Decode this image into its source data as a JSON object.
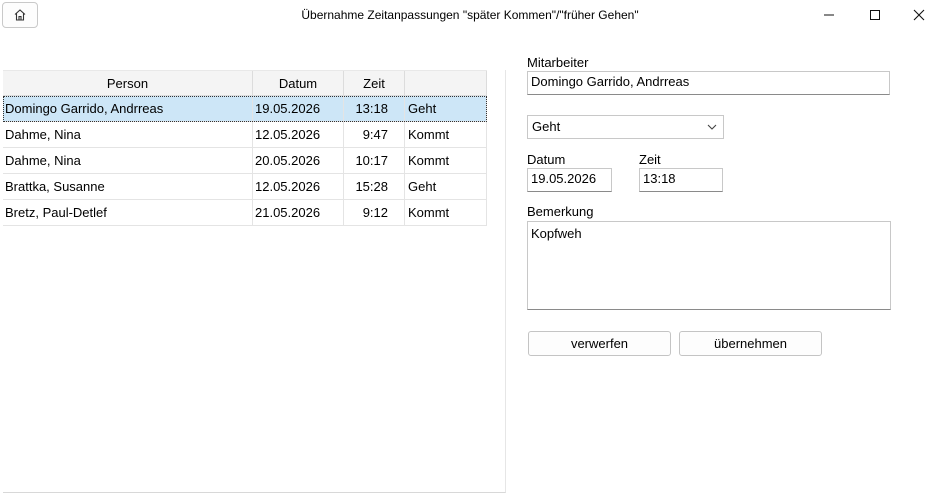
{
  "window": {
    "title": "Übernahme Zeitanpassungen \"später Kommen\"/\"früher Gehen\"",
    "home_icon": "home-icon",
    "minimize_icon": "minimize-icon",
    "maximize_icon": "maximize-icon",
    "close_icon": "close-icon"
  },
  "grid": {
    "columns": [
      "Person",
      "Datum",
      "Zeit",
      ""
    ],
    "rows": [
      {
        "person": "Domingo Garrido, Andrreas",
        "datum": "19.05.2026",
        "zeit": "13:18",
        "art": "Geht"
      },
      {
        "person": "Dahme, Nina",
        "datum": "12.05.2026",
        "zeit": "9:47",
        "art": "Kommt"
      },
      {
        "person": "Dahme, Nina",
        "datum": "20.05.2026",
        "zeit": "10:17",
        "art": "Kommt"
      },
      {
        "person": "Brattka, Susanne",
        "datum": "12.05.2026",
        "zeit": "15:28",
        "art": "Geht"
      },
      {
        "person": "Bretz, Paul-Detlef",
        "datum": "21.05.2026",
        "zeit": "9:12",
        "art": "Kommt"
      }
    ],
    "selected_index": 0
  },
  "form": {
    "mitarbeiter_label": "Mitarbeiter",
    "mitarbeiter_value": "Domingo Garrido, Andrreas",
    "art_value": "Geht",
    "datum_label": "Datum",
    "datum_value": "19.05.2026",
    "zeit_label": "Zeit",
    "zeit_value": "13:18",
    "bemerkung_label": "Bemerkung",
    "bemerkung_value": "Kopfweh",
    "verwerfen_label": "verwerfen",
    "uebernehmen_label": "übernehmen"
  },
  "colors": {
    "selection": "#cde6f7"
  }
}
